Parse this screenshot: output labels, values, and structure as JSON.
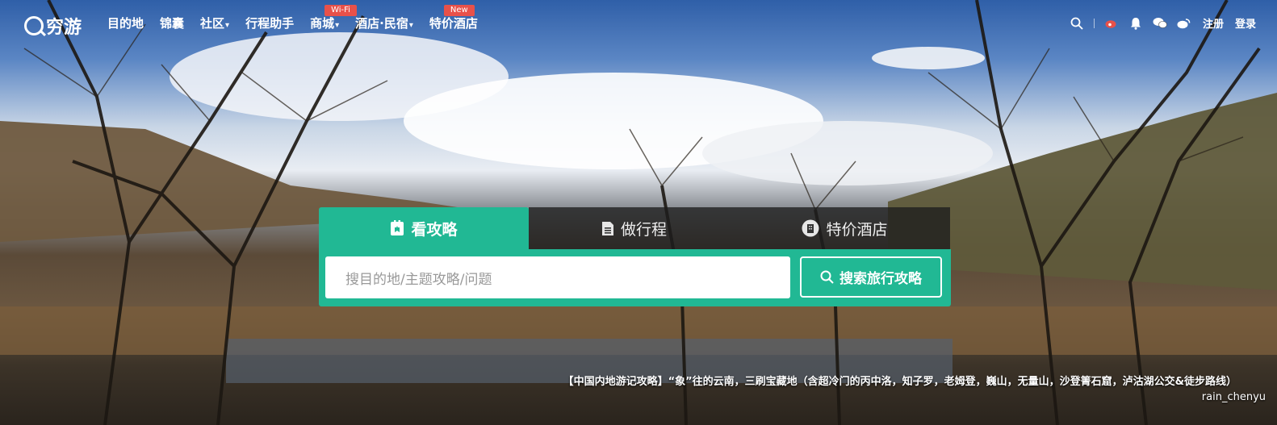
{
  "logo": {
    "text": "穷游"
  },
  "nav": {
    "items": [
      {
        "label": "目的地",
        "caret": false,
        "badge": ""
      },
      {
        "label": "锦囊",
        "caret": false,
        "badge": ""
      },
      {
        "label": "社区",
        "caret": true,
        "badge": ""
      },
      {
        "label": "行程助手",
        "caret": false,
        "badge": ""
      },
      {
        "label": "商城",
        "caret": true,
        "badge": "Wi-Fi"
      },
      {
        "label": "酒店·民宿",
        "caret": true,
        "badge": ""
      },
      {
        "label": "特价酒店",
        "caret": false,
        "badge": "New"
      }
    ],
    "register": "注册",
    "login": "登录"
  },
  "search": {
    "tabs": [
      {
        "label": "看攻略",
        "icon": "bookmark-icon",
        "active": true
      },
      {
        "label": "做行程",
        "icon": "document-icon",
        "active": false
      },
      {
        "label": "特价酒店",
        "icon": "hotel-icon",
        "active": false
      }
    ],
    "placeholder": "搜目的地/主题攻略/问题",
    "button": "搜索旅行攻略"
  },
  "feature": {
    "caption": "【中国内地游记攻略】“象”往的云南，三刷宝藏地（含超冷门的丙中洛，知子罗，老姆登，巍山，无量山，沙登箐石窟，泸沽湖公交&徒步路线）",
    "author": "rain_chenyu"
  },
  "colors": {
    "accent": "#21b894",
    "badge": "#e8514a"
  }
}
